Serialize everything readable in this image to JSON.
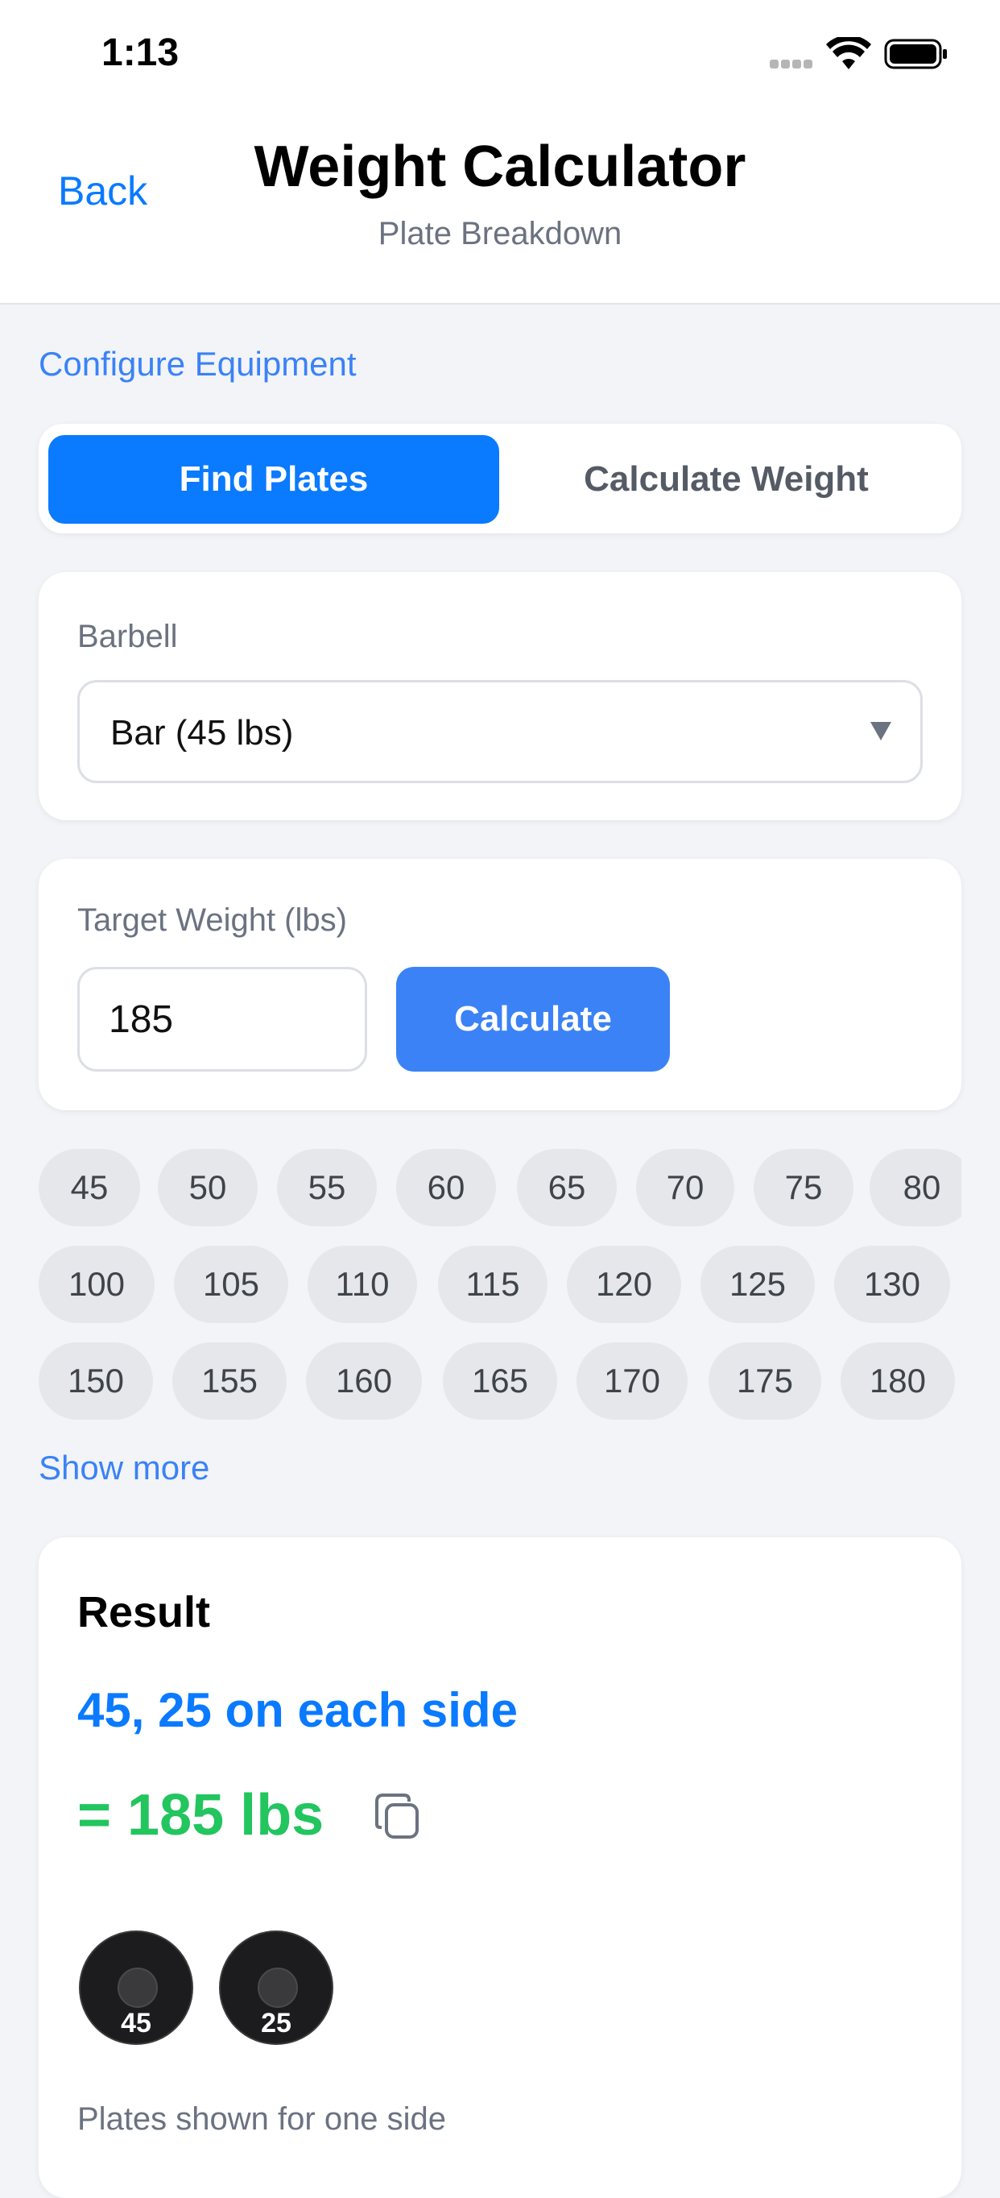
{
  "status": {
    "time": "1:13"
  },
  "nav": {
    "back_label": "Back",
    "title": "Weight Calculator",
    "subtitle": "Plate Breakdown"
  },
  "configure_link": "Configure Equipment",
  "tabs": [
    {
      "label": "Find Plates",
      "active": true
    },
    {
      "label": "Calculate Weight",
      "active": false
    }
  ],
  "barbell": {
    "label": "Barbell",
    "selected": "Bar (45 lbs)"
  },
  "target": {
    "label": "Target Weight (lbs)",
    "value": "185",
    "button_label": "Calculate"
  },
  "quick_weights": [
    [
      "45",
      "50",
      "55",
      "60",
      "65",
      "70",
      "75",
      "80"
    ],
    [
      "100",
      "105",
      "110",
      "115",
      "120",
      "125",
      "130"
    ],
    [
      "150",
      "155",
      "160",
      "165",
      "170",
      "175",
      "180"
    ]
  ],
  "show_more": "Show more",
  "result": {
    "heading": "Result",
    "plates_text": "45, 25 on each side",
    "total_text": "= 185 lbs",
    "plates": [
      "45",
      "25"
    ],
    "caption": "Plates shown for one side"
  },
  "colors": {
    "accent": "#0a7aff",
    "link": "#3b82f6",
    "success": "#22c55e",
    "plate": "#1c1c1e"
  },
  "icons": {
    "copy": "copy-icon",
    "dropdown": "chevron-down-icon",
    "wifi": "wifi-icon",
    "battery": "battery-icon",
    "signal": "signal-icon"
  }
}
